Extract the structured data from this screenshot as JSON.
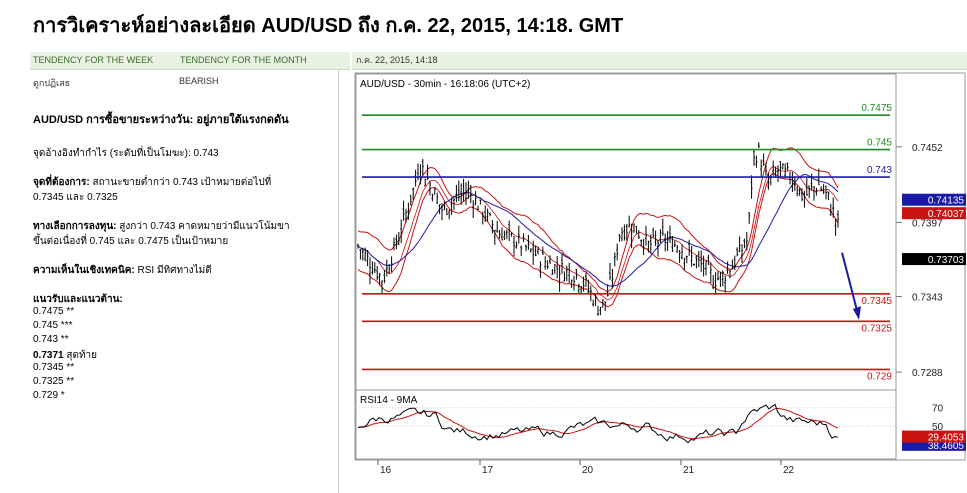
{
  "title": "การวิเคราะห์อย่างละเอียด AUD/USD ถึง ก.ค. 22, 2015, 14:18. GMT",
  "header": {
    "week_label": "TENDENCY FOR THE WEEK",
    "month_label": "TENDENCY FOR THE MONTH",
    "date": "ก.ค. 22, 2015, 14:18"
  },
  "sidebar": {
    "trend_label": "ดูกปฏิเสธ",
    "trend_value": "BEARISH",
    "headline": "AUD/USD การซื้อขายระหว่างวัน: อยู่ภายใต้แรงกดดัน",
    "pivot": "จุดอ้างอิงทำกำไร (ระดับที่เป็นโมฆะ): 0.743",
    "preference_label": "จุดที่ต้องการ:",
    "preference_text_1": " สถานะขายต่ำกว่า 0.743 เป้าหมายต่อไปที่",
    "preference_text_2": "0.7345 และ 0.7325",
    "alternative_label": "ทางเลือกการลงทุน:",
    "alternative_text_1": " สูงกว่า 0.743 คาดหมายว่ามีแนวโน้มขา",
    "alternative_text_2": "ขึ้นต่อเนื่องที่ 0.745 และ 0.7475 เป็นเป้าหมาย",
    "comment_label": "ความเห็นในเชิงเทคนิค:",
    "comment_text": " RSI มีทิศทางไม่ดี",
    "levels_title": "แนวรับและแนวต้าน:",
    "levels": [
      {
        "text": "0.7475 **",
        "bold": false
      },
      {
        "text": "0.745 ***",
        "bold": false
      },
      {
        "text": "0.743 **",
        "bold": false
      },
      {
        "text": "0.7371",
        "suffix": " สุดท้าย",
        "bold": true
      },
      {
        "text": "0.7345 **",
        "bold": false
      },
      {
        "text": "0.7325 **",
        "bold": false
      },
      {
        "text": "0.729 *",
        "bold": false
      }
    ]
  },
  "chart_data": [
    {
      "type": "candlestick",
      "title": "AUD/USD - 30min - 16:18:06 (UTC+2)",
      "x_tick_labels": [
        "16",
        "17",
        "20",
        "21",
        "22"
      ],
      "y_tick_labels": [
        "0.7452",
        "0.7397",
        "0.7343",
        "0.7288"
      ],
      "ylim": [
        0.7275,
        0.7505
      ],
      "horizontal_levels": [
        {
          "value": 0.7475,
          "label": "0.7475",
          "color": "#1e8c1e"
        },
        {
          "value": 0.745,
          "label": "0.745",
          "color": "#1e8c1e"
        },
        {
          "value": 0.743,
          "label": "0.743",
          "color": "#1a1aa6"
        },
        {
          "value": 0.7345,
          "label": "0.7345",
          "color": "#cc1111"
        },
        {
          "value": 0.7325,
          "label": "0.7325",
          "color": "#cc1111"
        },
        {
          "value": 0.729,
          "label": "0.729",
          "color": "#cc1111"
        }
      ],
      "price_tags": [
        {
          "value": 0.74135,
          "label": "0.74135",
          "color": "#1a1aa6"
        },
        {
          "value": 0.74037,
          "label": "0.74037",
          "color": "#cc1111"
        },
        {
          "value": 0.73703,
          "label": "0.73703",
          "color": "#000000"
        }
      ],
      "indicators": [
        "Bollinger bands (red)",
        "moving average (blue)"
      ],
      "arrow": "projected move down toward 0.7325"
    },
    {
      "type": "line",
      "title": "RSI14 - 9MA",
      "y_tick_labels": [
        "70",
        "50"
      ],
      "ylim": [
        15,
        85
      ],
      "series": [
        {
          "name": "RSI14",
          "last": 29.4053,
          "color": "#000000",
          "tag_color": "#1a1aa6"
        },
        {
          "name": "9MA",
          "last": 38.4605,
          "color": "#cc1111",
          "tag_color": "#cc1111"
        }
      ],
      "tag_labels": [
        "38.4605",
        "29.4053"
      ]
    }
  ],
  "colors": {
    "header_bg": "#e9f1e3",
    "header_text": "#3a6b2a",
    "bull": "#1e8c1e",
    "bear": "#cc1111",
    "blue": "#1a1aa6"
  }
}
